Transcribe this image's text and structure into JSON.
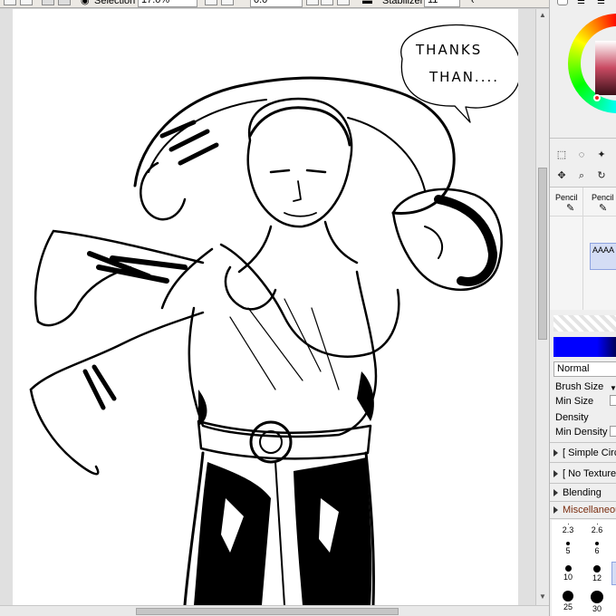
{
  "toolbar": {
    "selection_label": "Selection",
    "zoom_value": "17.0%",
    "rotation_value": "0.0",
    "stabilizer_label": "Stabilizer",
    "stabilizer_value": "11"
  },
  "artwork": {
    "speech_line1": "THANKS",
    "speech_line2": "THAN...."
  },
  "panel": {
    "tools": [
      {
        "name": "rect-select-icon",
        "glyph": "⬚"
      },
      {
        "name": "lasso-icon",
        "glyph": "◌"
      },
      {
        "name": "magic-wand-icon",
        "glyph": "✦"
      },
      {
        "name": "move-icon",
        "glyph": "✥"
      },
      {
        "name": "zoom-icon",
        "glyph": "⌕"
      },
      {
        "name": "rotate-icon",
        "glyph": "↻"
      }
    ],
    "brush_slots": [
      "Pencil",
      "Pencil"
    ],
    "selected_slot_label": "AAAA",
    "blend_mode": "Normal",
    "brush_size_label": "Brush Size",
    "min_size_label": "Min Size",
    "density_label": "Density",
    "min_density_label": "Min Density",
    "brush_shape": "[ Simple Circle ]",
    "texture": "[ No Texture ]",
    "blending_label": "Blending",
    "misc_label": "Miscellaneous",
    "brush_dots": [
      {
        "label": "2.3",
        "size": 1
      },
      {
        "label": "2.6",
        "size": 1
      },
      {
        "label": "5",
        "size": 4
      },
      {
        "label": "6",
        "size": 4
      },
      {
        "label": "10",
        "size": 7
      },
      {
        "label": "12",
        "size": 8
      },
      {
        "label": "25",
        "size": 12
      },
      {
        "label": "30",
        "size": 14
      }
    ],
    "main_color": "#0000ff"
  }
}
